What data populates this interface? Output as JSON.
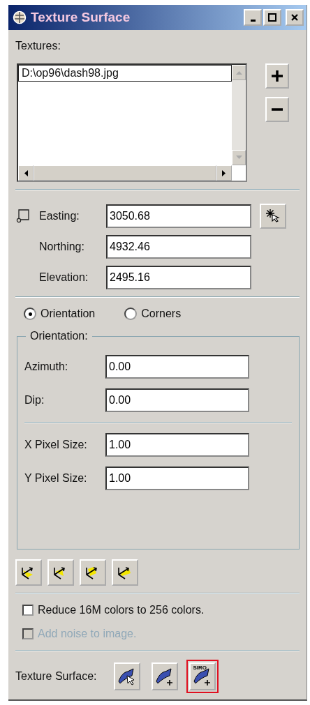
{
  "window": {
    "title": "Texture Surface"
  },
  "textures": {
    "label": "Textures:",
    "items": [
      {
        "path": "D:\\op96\\dash98.jpg",
        "selected": true
      }
    ]
  },
  "position": {
    "fields": [
      {
        "label": "Easting:",
        "value": "3050.68"
      },
      {
        "label": "Northing:",
        "value": "4932.46"
      },
      {
        "label": "Elevation:",
        "value": "2495.16"
      }
    ]
  },
  "mode": [
    {
      "label": "Orientation",
      "selected": true
    },
    {
      "label": "Corners",
      "selected": false
    }
  ],
  "orientation_group": {
    "title": "Orientation:",
    "fields": [
      {
        "label": "Azimuth:",
        "value": "0.00"
      },
      {
        "label": "Dip:",
        "value": "0.00"
      }
    ],
    "pixel_fields": [
      {
        "label": "X Pixel Size:",
        "value": "1.00"
      },
      {
        "label": "Y Pixel Size:",
        "value": "1.00"
      }
    ]
  },
  "options": [
    {
      "label": "Reduce 16M colors to 256 colors.",
      "checked": false,
      "disabled": false
    },
    {
      "label": "Add noise to image.",
      "checked": false,
      "disabled": true
    }
  ],
  "texture_surface": {
    "label": "Texture Surface:",
    "buttons": [
      {
        "kind": "pick",
        "highlighted": false
      },
      {
        "kind": "add",
        "highlighted": false
      },
      {
        "kind": "siro",
        "badge": "SIRO",
        "highlighted": true
      }
    ]
  }
}
